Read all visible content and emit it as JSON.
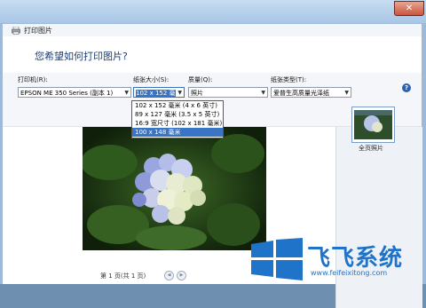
{
  "window": {
    "title": "打印图片",
    "close_label": "✕"
  },
  "header": {
    "prompt": "您希望如何打印图片?"
  },
  "printer": {
    "label": "打印机(R):",
    "value": "EPSON ME 350 Series (副本 1)"
  },
  "paper_size": {
    "label": "纸张大小(S):",
    "value": "102 x 152 毫",
    "options": [
      "102 x 152 毫米 (4 x 6 英寸)",
      "89 x 127 毫米 (3.5 x 5 英寸)",
      "16:9 宽尺寸 (102 x 181 毫米)",
      "100 x 148 毫米"
    ],
    "selected_index": 3
  },
  "quality": {
    "label": "质量(Q):",
    "value": "照片"
  },
  "paper_type": {
    "label": "纸张类型(T):",
    "value": "爱普生高质量光泽纸"
  },
  "help_icon": "question-icon",
  "pager": {
    "label": "第 1 页(共 1 页)",
    "prev_icon": "chevron-left-icon",
    "next_icon": "chevron-right-icon"
  },
  "layout": {
    "label": "全页照片"
  },
  "watermark": {
    "name": "飞飞系统",
    "url": "www.feifeixitong.com"
  },
  "colors": {
    "accent": "#3a74c4",
    "title_text": "#1f3e73",
    "watermark": "#1f73c9"
  }
}
